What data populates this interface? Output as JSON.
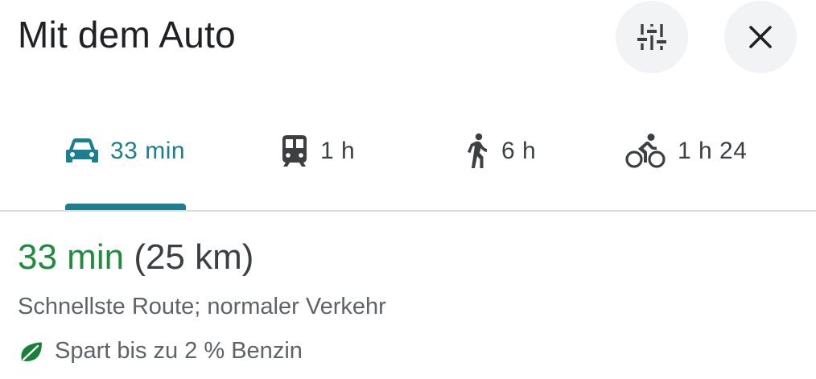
{
  "header": {
    "title": "Mit dem Auto",
    "filters_icon": "tune-sliders-icon",
    "close_icon": "close-icon"
  },
  "tabs": [
    {
      "mode": "drive",
      "icon": "car-icon",
      "label": "33 min",
      "active": true
    },
    {
      "mode": "transit",
      "icon": "train-icon",
      "label": "1 h",
      "active": false
    },
    {
      "mode": "walk",
      "icon": "walk-icon",
      "label": "6 h",
      "active": false
    },
    {
      "mode": "bike",
      "icon": "bike-icon",
      "label": "1 h 24",
      "active": false
    }
  ],
  "route": {
    "duration": "33 min",
    "distance": "(25 km)",
    "description": "Schnellste Route; normaler Verkehr",
    "eco_text": "Spart bis zu 2 % Benzin",
    "eco_icon": "leaf-icon"
  },
  "colors": {
    "accent": "#1a7f8e",
    "duration_green": "#1e8e3e",
    "eco_leaf": "#188038",
    "text_primary": "#202124",
    "text_secondary": "#5f6368",
    "button_bg": "#f1f3f4"
  }
}
